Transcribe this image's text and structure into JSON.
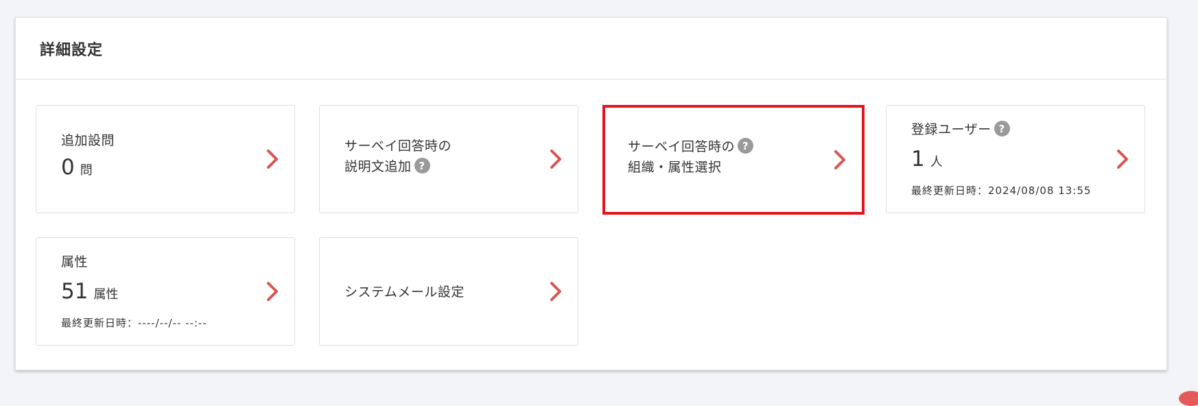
{
  "panel": {
    "title": "詳細設定"
  },
  "accent_color": "#d9534f",
  "highlight_color": "#e0151f",
  "cards": {
    "additional_questions": {
      "title": "追加設問",
      "value": "0",
      "unit": "問"
    },
    "description": {
      "line1": "サーベイ回答時の",
      "line2": "説明文追加",
      "help": "?"
    },
    "org_select": {
      "line1": "サーベイ回答時の",
      "line2": "組織・属性選択",
      "help": "?"
    },
    "users": {
      "title": "登録ユーザー",
      "help": "?",
      "value": "1",
      "unit": "人",
      "updated": "最終更新日時：2024/08/08 13:55"
    },
    "attributes": {
      "title": "属性",
      "value": "51",
      "unit": "属性",
      "updated": "最終更新日時：----/--/-- --:--"
    },
    "system_mail": {
      "title": "システムメール設定"
    }
  },
  "icons": {
    "chevron": "chevron-right-icon",
    "help": "question-circle-icon"
  }
}
